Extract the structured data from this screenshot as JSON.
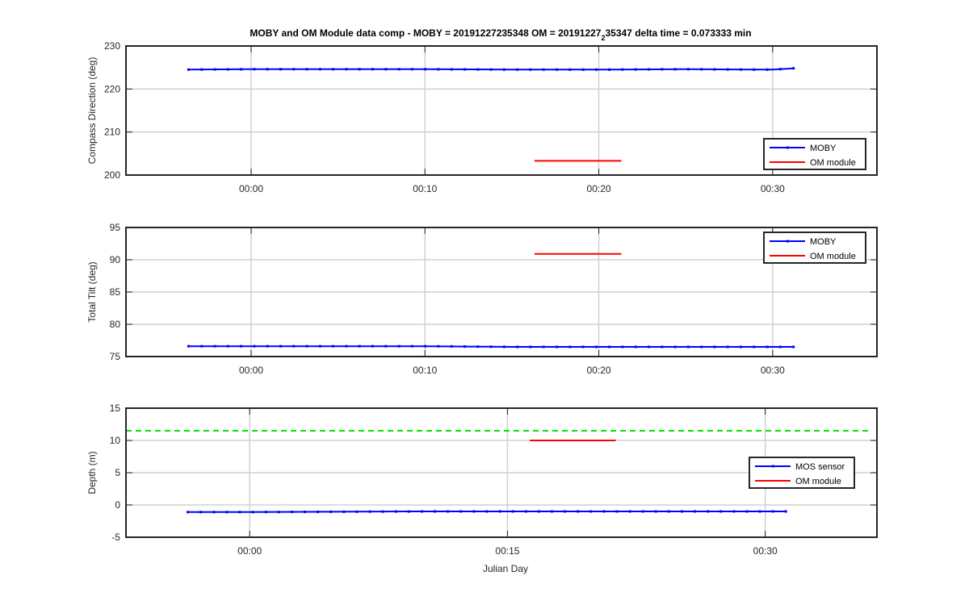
{
  "figure": {
    "title_prefix": "MOBY and OM Module data comp - MOBY = 20191227235348 OM = 20191227",
    "title_sub": "2",
    "title_suffix": "35347 delta time = 0.073333 min"
  },
  "colors": {
    "moby": "#0000ff",
    "om": "#ff0000",
    "threshold": "#00e600",
    "grid": "#d0d0d0",
    "axis": "#262626"
  },
  "chart_data": [
    {
      "type": "line",
      "ylabel": "Compass Direction (deg)",
      "xlabel": "",
      "xlim_min": [
        -7.2,
        36.0
      ],
      "ylim": [
        200,
        230
      ],
      "yticks": [
        200,
        210,
        220,
        230
      ],
      "xticks": [
        {
          "value_min": 0,
          "label": "00:00"
        },
        {
          "value_min": 10,
          "label": "00:10"
        },
        {
          "value_min": 20,
          "label": "00:20"
        },
        {
          "value_min": 30,
          "label": "00:30"
        }
      ],
      "grid": true,
      "legend": {
        "position": "bottom-right",
        "entries": [
          "MOBY",
          "OM module"
        ]
      },
      "series": [
        {
          "name": "MOBY",
          "color_key": "moby",
          "markers": true,
          "x_min": [
            -3.6,
            0,
            5,
            10,
            15,
            20,
            25,
            29,
            30,
            31.2
          ],
          "y": [
            224.5,
            224.6,
            224.6,
            224.6,
            224.5,
            224.5,
            224.6,
            224.5,
            224.5,
            224.8
          ]
        },
        {
          "name": "OM module",
          "color_key": "om",
          "markers": false,
          "x_min": [
            16.3,
            21.3
          ],
          "y": [
            203.3,
            203.3
          ]
        }
      ]
    },
    {
      "type": "line",
      "ylabel": "Total Tilt (deg)",
      "xlabel": "",
      "xlim_min": [
        -7.2,
        36.0
      ],
      "ylim": [
        75,
        95
      ],
      "yticks": [
        75,
        80,
        85,
        90,
        95
      ],
      "xticks": [
        {
          "value_min": 0,
          "label": "00:00"
        },
        {
          "value_min": 10,
          "label": "00:10"
        },
        {
          "value_min": 20,
          "label": "00:20"
        },
        {
          "value_min": 30,
          "label": "00:30"
        }
      ],
      "grid": true,
      "legend": {
        "position": "top-right",
        "entries": [
          "MOBY",
          "OM module"
        ]
      },
      "series": [
        {
          "name": "MOBY",
          "color_key": "moby",
          "markers": true,
          "x_min": [
            -3.6,
            0,
            10,
            15,
            20,
            25,
            31.2
          ],
          "y": [
            76.6,
            76.6,
            76.6,
            76.5,
            76.5,
            76.5,
            76.5
          ]
        },
        {
          "name": "OM module",
          "color_key": "om",
          "markers": false,
          "x_min": [
            16.3,
            21.3
          ],
          "y": [
            90.9,
            90.9
          ]
        }
      ]
    },
    {
      "type": "line",
      "ylabel": "Depth (m)",
      "xlabel": "Julian Day",
      "xlim_min": [
        -7.2,
        36.5
      ],
      "ylim": [
        -5,
        15
      ],
      "yticks": [
        -5,
        0,
        5,
        10,
        15
      ],
      "xticks": [
        {
          "value_min": 0,
          "label": "00:00"
        },
        {
          "value_min": 15,
          "label": "00:15"
        },
        {
          "value_min": 30,
          "label": "00:30"
        }
      ],
      "grid": true,
      "legend": {
        "position": "center-right",
        "entries": [
          "MOS sensor",
          "OM module"
        ]
      },
      "threshold": {
        "y": 11.5,
        "x_min": [
          -7.2,
          36.0
        ],
        "style": "dashed"
      },
      "series": [
        {
          "name": "MOS sensor",
          "color_key": "moby",
          "markers": true,
          "x_min": [
            -3.6,
            0,
            10,
            20,
            25,
            31.2
          ],
          "y": [
            -1.1,
            -1.1,
            -1.0,
            -1.0,
            -1.0,
            -1.0
          ]
        },
        {
          "name": "OM module",
          "color_key": "om",
          "markers": false,
          "x_min": [
            16.3,
            21.3
          ],
          "y": [
            10.0,
            10.0
          ]
        }
      ]
    }
  ]
}
